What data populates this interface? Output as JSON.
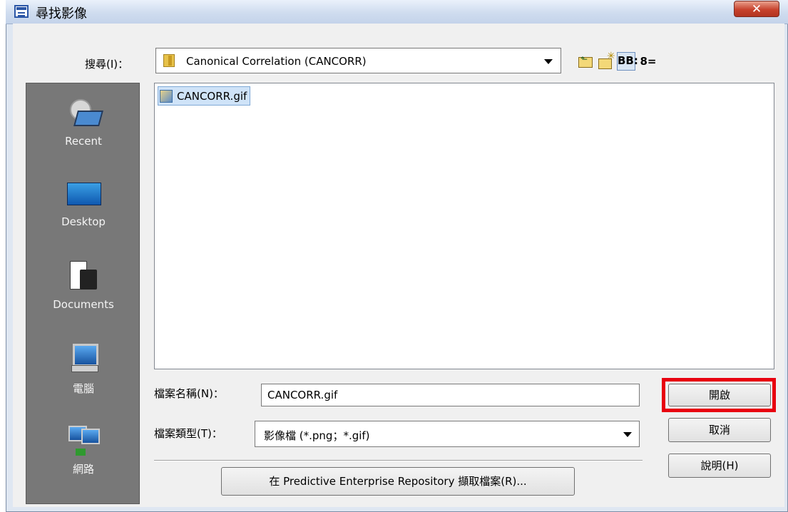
{
  "window": {
    "title": "尋找影像",
    "close_symbol": "✕"
  },
  "lookin": {
    "label": "搜尋(I)：",
    "value": "Canonical Correlation (CANCORR)"
  },
  "toolbar": {
    "list_glyph": "BB:",
    "details_glyph": "8="
  },
  "places": [
    {
      "label": "Recent",
      "icon": "recent-icon"
    },
    {
      "label": "Desktop",
      "icon": "desktop-icon"
    },
    {
      "label": "Documents",
      "icon": "documents-icon"
    },
    {
      "label": "電腦",
      "icon": "computer-icon"
    },
    {
      "label": "網路",
      "icon": "network-icon"
    }
  ],
  "files": [
    {
      "name": "CANCORR.gif",
      "selected": true
    }
  ],
  "filename": {
    "label": "檔案名稱(N)：",
    "value": "CANCORR.gif"
  },
  "filetype": {
    "label": "檔案類型(T)：",
    "value": "影像檔 (*.png；*.gif)"
  },
  "buttons": {
    "open": "開啟",
    "cancel": "取消",
    "help": "說明(H)",
    "repository": "在 Predictive Enterprise Repository 擷取檔案(R)..."
  },
  "colors": {
    "highlight": "#e8000f",
    "places_bg": "#787878",
    "selection": "#cfe3f8"
  }
}
